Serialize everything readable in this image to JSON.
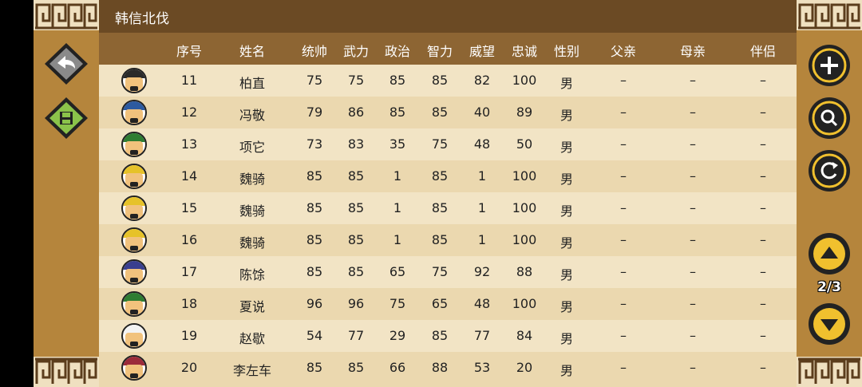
{
  "title": "韩信北伐",
  "headers": {
    "index": "序号",
    "name": "姓名",
    "tongshuai": "统帅",
    "wuli": "武力",
    "zhengzhi": "政治",
    "zhili": "智力",
    "weiwang": "威望",
    "zhongcheng": "忠诚",
    "sex": "性别",
    "father": "父亲",
    "mother": "母亲",
    "mate": "伴侣"
  },
  "rows": [
    {
      "idx": "11",
      "name": "柏直",
      "tong": "75",
      "wu": "75",
      "zheng": "85",
      "zhi": "85",
      "wei": "82",
      "zhong": "100",
      "sex": "男",
      "father": "–",
      "mother": "–",
      "mate": "–",
      "hat": "#2a2a2a"
    },
    {
      "idx": "12",
      "name": "冯敬",
      "tong": "79",
      "wu": "86",
      "zheng": "85",
      "zhi": "85",
      "wei": "40",
      "zhong": "89",
      "sex": "男",
      "father": "–",
      "mother": "–",
      "mate": "–",
      "hat": "#2c5aa0"
    },
    {
      "idx": "13",
      "name": "项它",
      "tong": "73",
      "wu": "83",
      "zheng": "35",
      "zhi": "75",
      "wei": "48",
      "zhong": "50",
      "sex": "男",
      "father": "–",
      "mother": "–",
      "mate": "–",
      "hat": "#2e7d32"
    },
    {
      "idx": "14",
      "name": "魏骑",
      "tong": "85",
      "wu": "85",
      "zheng": "1",
      "zhi": "85",
      "wei": "1",
      "zhong": "100",
      "sex": "男",
      "father": "–",
      "mother": "–",
      "mate": "–",
      "hat": "#e6c229"
    },
    {
      "idx": "15",
      "name": "魏骑",
      "tong": "85",
      "wu": "85",
      "zheng": "1",
      "zhi": "85",
      "wei": "1",
      "zhong": "100",
      "sex": "男",
      "father": "–",
      "mother": "–",
      "mate": "–",
      "hat": "#e6c229"
    },
    {
      "idx": "16",
      "name": "魏骑",
      "tong": "85",
      "wu": "85",
      "zheng": "1",
      "zhi": "85",
      "wei": "1",
      "zhong": "100",
      "sex": "男",
      "father": "–",
      "mother": "–",
      "mate": "–",
      "hat": "#e6c229"
    },
    {
      "idx": "17",
      "name": "陈馀",
      "tong": "85",
      "wu": "85",
      "zheng": "65",
      "zhi": "75",
      "wei": "92",
      "zhong": "88",
      "sex": "男",
      "father": "–",
      "mother": "–",
      "mate": "–",
      "hat": "#3a3f8f"
    },
    {
      "idx": "18",
      "name": "夏说",
      "tong": "96",
      "wu": "96",
      "zheng": "75",
      "zhi": "65",
      "wei": "48",
      "zhong": "100",
      "sex": "男",
      "father": "–",
      "mother": "–",
      "mate": "–",
      "hat": "#2e7d32"
    },
    {
      "idx": "19",
      "name": "赵歇",
      "tong": "54",
      "wu": "77",
      "zheng": "29",
      "zhi": "85",
      "wei": "77",
      "zhong": "84",
      "sex": "男",
      "father": "–",
      "mother": "–",
      "mate": "–",
      "hat": "#f3f3f3"
    },
    {
      "idx": "20",
      "name": "李左车",
      "tong": "85",
      "wu": "85",
      "zheng": "66",
      "zhi": "88",
      "wei": "53",
      "zhong": "20",
      "sex": "男",
      "father": "–",
      "mother": "–",
      "mate": "–",
      "hat": "#9c2b3a"
    }
  ],
  "pagination": "2/3",
  "icons": {
    "back": "back-arrow-icon",
    "save": "save-disk-icon",
    "add": "plus-icon",
    "search": "magnifier-icon",
    "refresh": "refresh-icon",
    "page_up": "triangle-up-icon",
    "page_down": "triangle-down-icon"
  },
  "colors": {
    "title_bg": "#6b4a24",
    "header_bg": "#8d6533",
    "row_light": "#f2e4c5",
    "row_dark": "#ebd8af",
    "side": "#b5853c",
    "accent_green": "#8bc34a"
  }
}
